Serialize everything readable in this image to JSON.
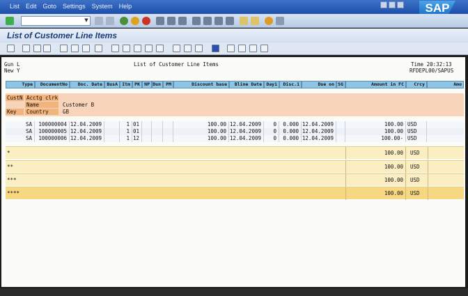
{
  "menu": [
    "List",
    "Edit",
    "Goto",
    "Settings",
    "System",
    "Help"
  ],
  "brand": "SAP",
  "title": "List of Customer Line Items",
  "header": {
    "left_line1": "Gun L",
    "left_line2": "New Y",
    "center": "List of Customer Line Items",
    "time": "Time 20:32:13",
    "program": "RFDEPL00/SAPUS"
  },
  "columns": [
    "Type",
    "DocumentNo",
    "Doc. Date",
    "BusA",
    "Itm",
    "PK",
    "NP",
    "Dun",
    "PM",
    "Discount base",
    "Bline Date",
    "Day1",
    "Disc.1",
    "Due on",
    "SG",
    "Amount in FC",
    "Crcy",
    "Amo"
  ],
  "group": {
    "custn_label": "CustN",
    "acctg_label": "Acctg clrk",
    "name_label": "Name",
    "name_value": "Customer B",
    "key_label": "Key",
    "country_label": "Country",
    "country_value": "GB"
  },
  "rows": [
    {
      "type": "SA",
      "doc": "100000004",
      "date": "12.04.2009",
      "itm": "1",
      "pk": "01",
      "base": "100.00",
      "bline": "12.04.2009",
      "day1": "0",
      "disc": "0.000",
      "due": "12.04.2009",
      "amt": "100.00",
      "cur": "USD"
    },
    {
      "type": "SA",
      "doc": "100000005",
      "date": "12.04.2009",
      "itm": "1",
      "pk": "01",
      "base": "100.00",
      "bline": "12.04.2009",
      "day1": "0",
      "disc": "0.000",
      "due": "12.04.2009",
      "amt": "100.00",
      "cur": "USD"
    },
    {
      "type": "SA",
      "doc": "100000006",
      "date": "12.04.2009",
      "itm": "1",
      "pk": "12",
      "base": "100.00",
      "bline": "12.04.2009",
      "day1": "0",
      "disc": "0.000",
      "due": "12.04.2009",
      "amt": "100.00-",
      "cur": "USD"
    }
  ],
  "totals": [
    {
      "label": "*",
      "amt": "100.00",
      "cur": "USD"
    },
    {
      "label": "**",
      "amt": "100.00",
      "cur": "USD"
    },
    {
      "label": "***",
      "amt": "100.00",
      "cur": "USD"
    },
    {
      "label": "****",
      "amt": "100.00",
      "cur": "USD"
    }
  ],
  "colors": {
    "header_blue": "#8ec4e4",
    "group_orange": "#f2b47d",
    "total_yellow": "#fbeec2"
  }
}
